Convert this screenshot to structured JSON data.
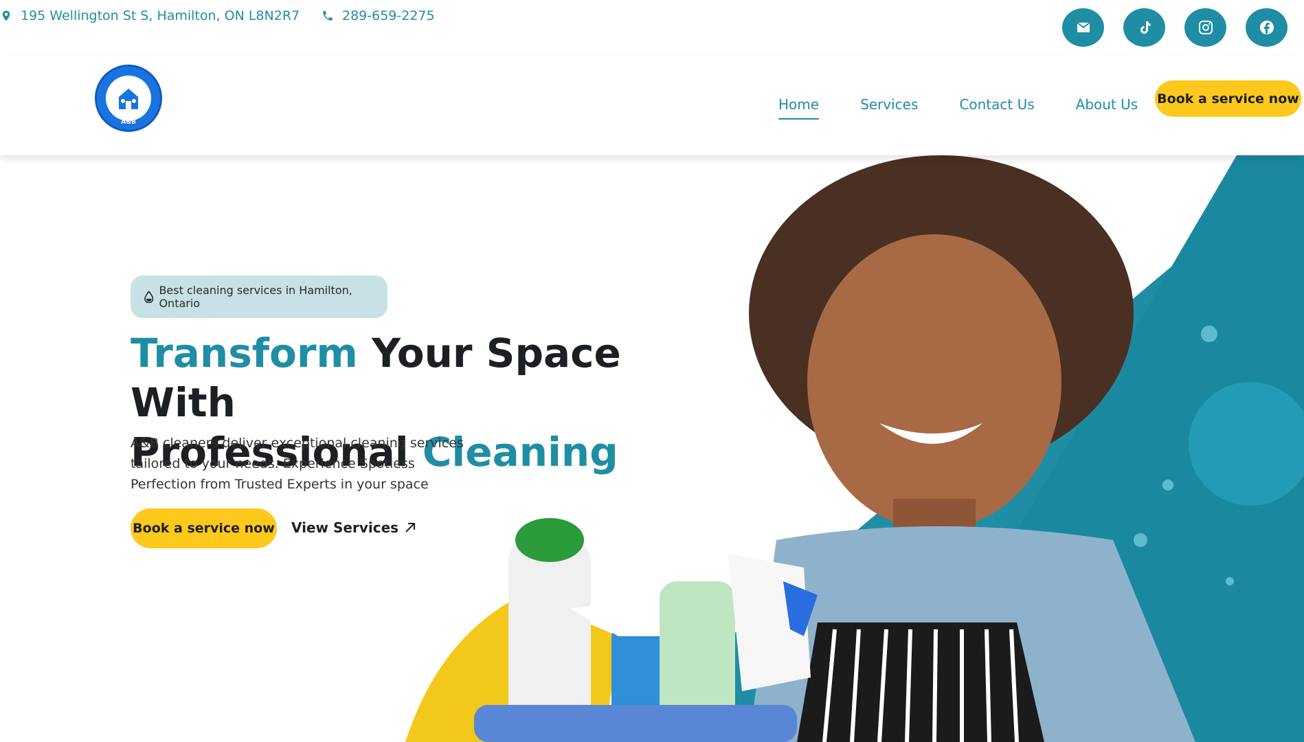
{
  "topbar": {
    "address": "195 Wellington St S, Hamilton, ON L8N2R7",
    "phone": "289-659-2275",
    "socials": [
      "email",
      "tiktok",
      "instagram",
      "facebook"
    ]
  },
  "header": {
    "logo_text": "A&B",
    "nav": [
      "Home",
      "Services",
      "Contact Us",
      "About Us"
    ],
    "active": "Home",
    "cta": "Book a service now"
  },
  "hero": {
    "badge": "Best cleaning services in Hamilton, Ontario",
    "headline_part1": "Transform",
    "headline_part2": " Your Space With",
    "headline_part3": "Professional ",
    "headline_part4": "Cleaning",
    "subtext": "A&B cleaners deliver exceptional cleaning services tailored to your needs. Experience Spotless Perfection from Trusted Experts in your space",
    "cta": "Book a service now",
    "secondary": "View Services"
  },
  "colors": {
    "teal": "#1f8ea5",
    "yellow": "#fcc91c",
    "badge_bg": "#c7e1e5"
  }
}
